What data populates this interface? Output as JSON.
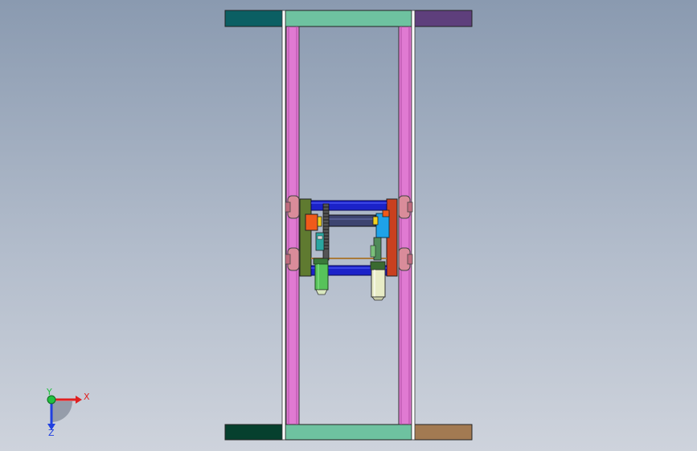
{
  "view": {
    "background_top": "#8a9ab0",
    "background_bottom": "#ced3dc"
  },
  "colors": {
    "frame_rail": "#e07ad2",
    "frame_rail_dark": "#b24ea6",
    "crossbar": "#6ec2a0",
    "top_left_block": "#0b5f63",
    "top_right_block": "#5e3f7c",
    "bottom_left_block": "#06402e",
    "bottom_right_block": "#a27a52",
    "roller_bar": "#1b22c9",
    "plate_left": "#5f7a30",
    "plate_right": "#c9401f",
    "motor_left": "#57c25a",
    "motor_right": "#e8ecc6",
    "bracket_orange": "#f05a1a",
    "bracket_cyan": "#1ea2e8",
    "wheel": "#d98c9a",
    "gear_rack": "#3a3a3a"
  },
  "triad": {
    "x_label": "X",
    "y_label": "Y",
    "z_label": "Z",
    "x_color": "#e02020",
    "y_color": "#22c040",
    "z_color": "#2040e0"
  }
}
